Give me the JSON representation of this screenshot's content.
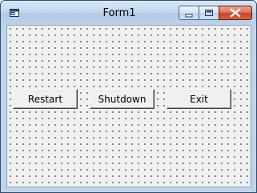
{
  "window": {
    "title": "Form1",
    "app_icon": "form-window-icon",
    "controls": {
      "minimize_icon": "minimize-icon",
      "maximize_icon": "maximize-icon",
      "close_icon": "close-icon"
    }
  },
  "form": {
    "buttons": [
      {
        "label": "Restart"
      },
      {
        "label": "Shutdown"
      },
      {
        "label": "Exit"
      }
    ]
  },
  "colors": {
    "titlebar": "#c3d8ee",
    "client_background": "#f0f0f0",
    "close_button": "#c5442a"
  }
}
